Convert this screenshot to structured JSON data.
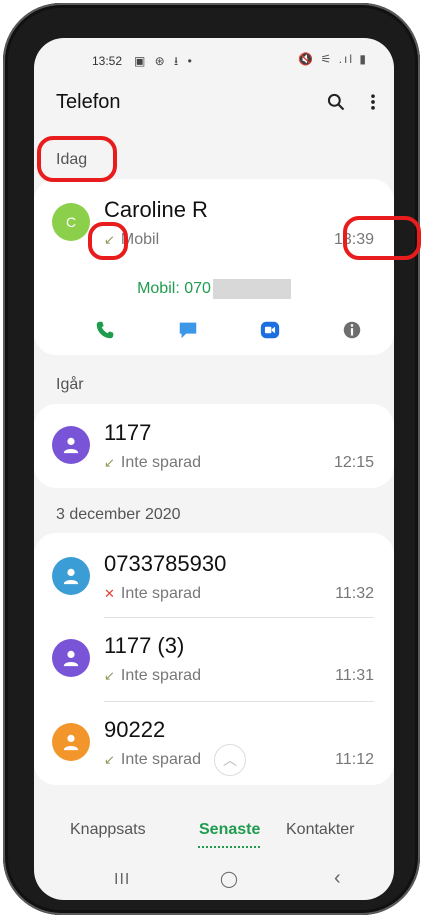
{
  "status": {
    "time": "13:52",
    "left_icons": "▣ ⊛ ⭳ •",
    "right_icons": "🔇 ⚟ .ıl ▮"
  },
  "app": {
    "title": "Telefon"
  },
  "sections": [
    {
      "label": "Idag"
    },
    {
      "label": "Igår"
    },
    {
      "label": "3 december 2020"
    }
  ],
  "expanded_contact": {
    "initial": "C",
    "name": "Caroline R",
    "type": "Mobil",
    "time": "13:39",
    "number_prefix": "Mobil: 070",
    "avatar_color": "#8ccf4a"
  },
  "calls_yesterday": [
    {
      "name": "1177",
      "status": "Inte sparad",
      "time": "12:15",
      "avatar_color": "#7a54d6"
    }
  ],
  "calls_dec3": [
    {
      "name": "0733785930",
      "status": "Inte sparad",
      "time": "11:32",
      "avatar_color": "#3a9dd6",
      "missed": true
    },
    {
      "name": "1177 (3)",
      "status": "Inte sparad",
      "time": "11:31",
      "avatar_color": "#7a54d6"
    },
    {
      "name": "90222",
      "status": "Inte sparad",
      "time": "11:12",
      "avatar_color": "#f2962c"
    }
  ],
  "tabs": {
    "keypad": "Knappsats",
    "recent": "Senaste",
    "contacts": "Kontakter"
  },
  "nav": {
    "recents": "III",
    "home": "◯",
    "back": "‹"
  }
}
